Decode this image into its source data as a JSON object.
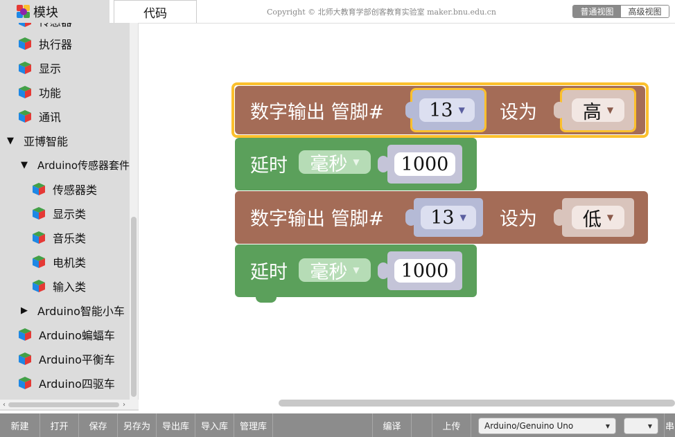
{
  "header": {
    "tab_blocks": "模块",
    "tab_code": "代码",
    "copyright": "Copyright © 北师大教育学部创客教育实验室 maker.bnu.edu.cn",
    "view_normal": "普通视图",
    "view_advanced": "高级视图"
  },
  "sidebar": {
    "items": [
      {
        "label": "传感器",
        "kind": "category",
        "icon": "cube-icon"
      },
      {
        "label": "执行器",
        "kind": "category",
        "icon": "cube-icon"
      },
      {
        "label": "显示",
        "kind": "category",
        "icon": "cube-icon"
      },
      {
        "label": "功能",
        "kind": "category",
        "icon": "cube-icon"
      },
      {
        "label": "通讯",
        "kind": "category",
        "icon": "cube-icon"
      },
      {
        "label": "亚博智能",
        "kind": "group-expanded",
        "icon": "triangle-down-icon"
      },
      {
        "label": "Arduino传感器套件",
        "kind": "group-expanded",
        "icon": "triangle-down-icon"
      },
      {
        "label": "传感器类",
        "kind": "category",
        "icon": "cube-icon"
      },
      {
        "label": "显示类",
        "kind": "category",
        "icon": "cube-icon"
      },
      {
        "label": "音乐类",
        "kind": "category",
        "icon": "cube-icon"
      },
      {
        "label": "电机类",
        "kind": "category",
        "icon": "cube-icon"
      },
      {
        "label": "输入类",
        "kind": "category",
        "icon": "cube-icon"
      },
      {
        "label": "Arduino智能小车",
        "kind": "group-collapsed",
        "icon": "triangle-right-icon"
      },
      {
        "label": "Arduino蝙蝠车",
        "kind": "category",
        "icon": "cube-icon"
      },
      {
        "label": "Arduino平衡车",
        "kind": "category",
        "icon": "cube-icon"
      },
      {
        "label": "Arduino四驱车",
        "kind": "category",
        "icon": "cube-icon"
      }
    ]
  },
  "blocks": [
    {
      "type": "digital-write",
      "label": "数字输出 管脚#",
      "pin": "13",
      "set_label": "设为",
      "level": "高",
      "selected": true,
      "color": "#a46c57"
    },
    {
      "type": "delay",
      "label": "延时",
      "unit": "毫秒",
      "value": "1000",
      "color": "#5ba05b"
    },
    {
      "type": "digital-write",
      "label": "数字输出 管脚#",
      "pin": "13",
      "set_label": "设为",
      "level": "低",
      "selected": false,
      "color": "#a46c57"
    },
    {
      "type": "delay",
      "label": "延时",
      "unit": "毫秒",
      "value": "1000",
      "color": "#5ba05b"
    }
  ],
  "toolbar": {
    "new": "新建",
    "open": "打开",
    "save": "保存",
    "save_as": "另存为",
    "export_lib": "导出库",
    "import_lib": "导入库",
    "manage_lib": "管理库",
    "compile": "编译",
    "upload": "上传",
    "board": "Arduino/Genuino Uno",
    "port": "",
    "serial": "串"
  },
  "colors": {
    "selection": "#fbc02d",
    "sidebar_bg": "#dcdcdc",
    "toolbar_bg": "#8c8c8c"
  }
}
